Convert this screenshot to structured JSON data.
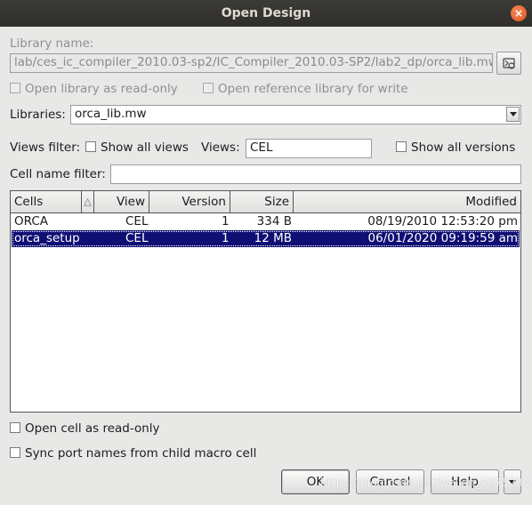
{
  "window": {
    "title": "Open Design",
    "close_glyph": "×"
  },
  "library": {
    "name_label": "Library name:",
    "name_value": "lab/ces_ic_compiler_2010.03-sp2/IC_Compiler_2010.03-SP2/lab2_dp/orca_lib.mw",
    "browse_icon": "folder-browse-icon",
    "open_readonly_label": "Open library as read-only",
    "open_reference_label": "Open reference library for write",
    "libraries_label": "Libraries:",
    "libraries_value": "orca_lib.mw"
  },
  "filters": {
    "views_filter_label": "Views filter:",
    "show_all_views_label": "Show all views",
    "views_label": "Views:",
    "views_value": "CEL",
    "show_all_versions_label": "Show all versions",
    "cell_name_filter_label": "Cell name filter:",
    "cell_name_filter_value": ""
  },
  "table": {
    "headers": {
      "cells": "Cells",
      "view": "View",
      "version": "Version",
      "size": "Size",
      "modified": "Modified"
    },
    "sort_indicator": "△",
    "rows": [
      {
        "cell": "ORCA",
        "view": "CEL",
        "version": "1",
        "size": "334 B",
        "modified": "08/19/2010 12:53:20 pm",
        "selected": false
      },
      {
        "cell": "orca_setup",
        "view": "CEL",
        "version": "1",
        "size": "12 MB",
        "modified": "06/01/2020 09:19:59 am",
        "selected": true
      }
    ]
  },
  "options": {
    "open_cell_readonly_label": "Open cell as read-only",
    "sync_port_names_label": "Sync port names from child macro cell"
  },
  "buttons": {
    "ok": "OK",
    "cancel": "Cancel",
    "help": "Help"
  },
  "watermark": "https://blog.csdn.net/weixin_46752319",
  "colors": {
    "titlebar": "#3c3b37",
    "selection": "#0f0f73",
    "close": "#e0501f"
  }
}
